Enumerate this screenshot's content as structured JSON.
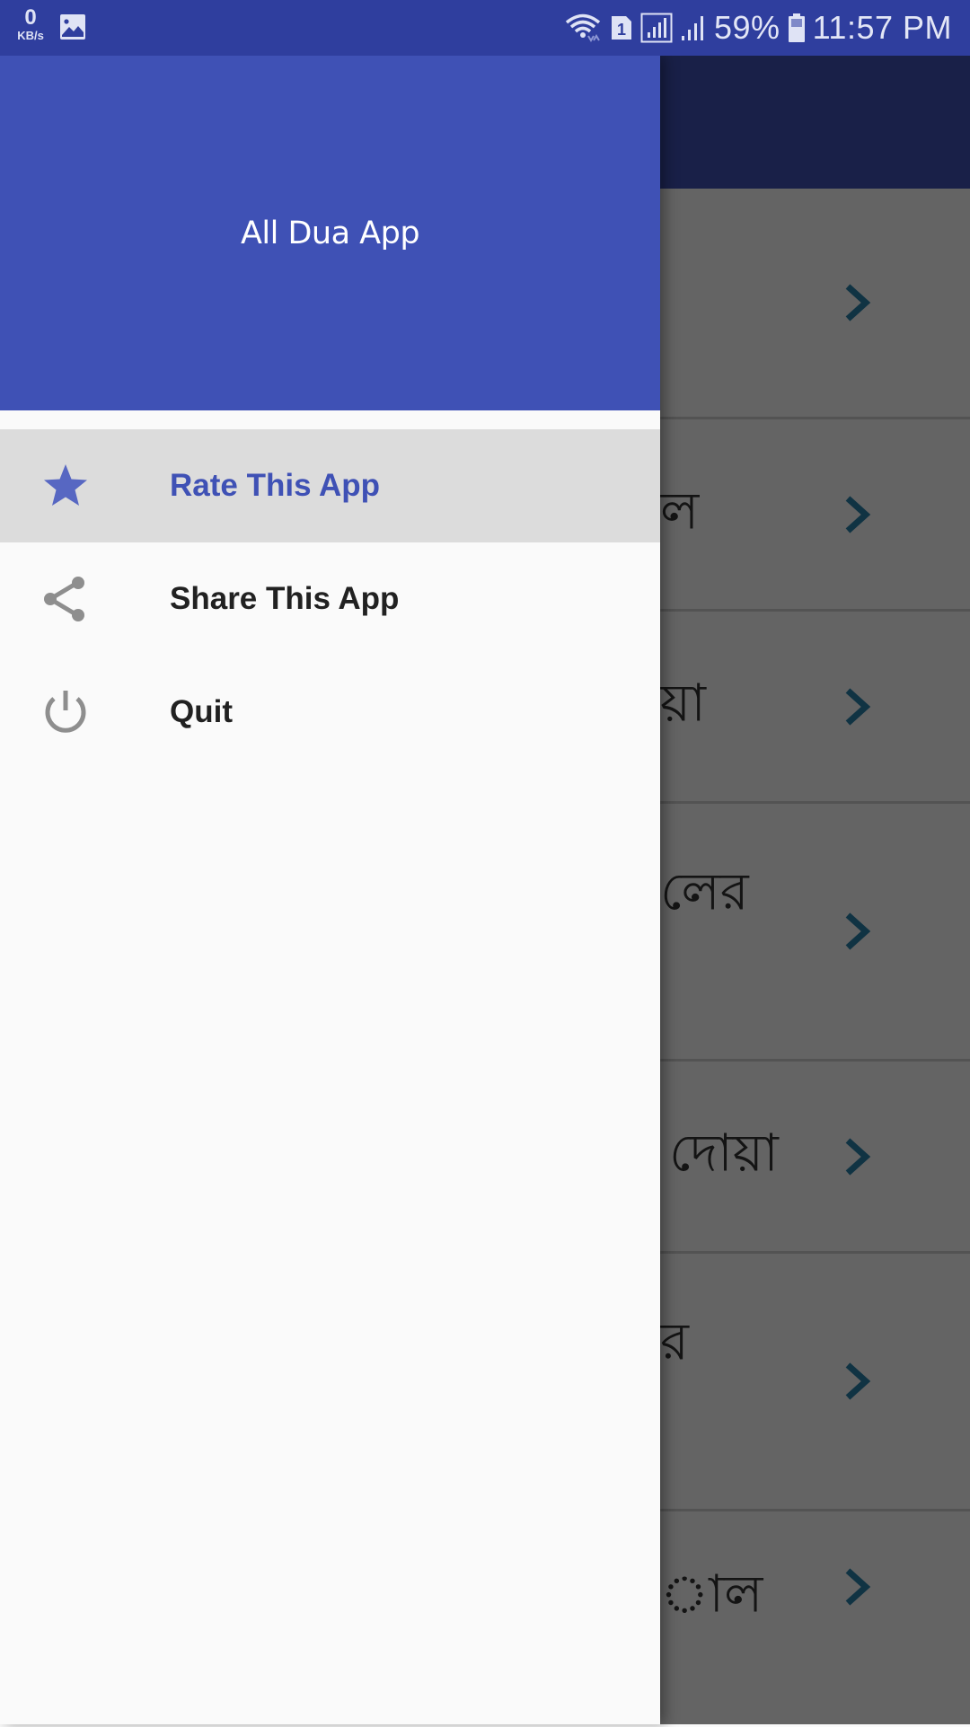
{
  "status_bar": {
    "net_speed_value": "0",
    "net_speed_unit": "KB/s",
    "notification_icons": [
      "gallery-icon"
    ],
    "system_icons": [
      "wifi-icon",
      "sim-1-icon",
      "signal-sim1-icon",
      "signal-sim2-icon"
    ],
    "battery_percent": "59%",
    "time": "11:57 PM"
  },
  "drawer": {
    "header_title": "All Dua App",
    "items": [
      {
        "label": "Rate This App",
        "icon": "star-icon",
        "active": true
      },
      {
        "label": "Share This App",
        "icon": "share-icon",
        "active": false
      },
      {
        "label": "Quit",
        "icon": "power-icon",
        "active": false
      }
    ]
  },
  "main_list": {
    "rows": [
      {
        "text": ""
      },
      {
        "text": "ল"
      },
      {
        "text": "য়া"
      },
      {
        "text": "লের"
      },
      {
        "text": "দোয়া"
      },
      {
        "text": "র"
      },
      {
        "text": "াল"
      }
    ]
  },
  "colors": {
    "primary": "#3F51B5",
    "status_bar": "#2F3E9E",
    "active_item_bg": "#DCDCDC",
    "chevron": "#2a7fa8"
  }
}
